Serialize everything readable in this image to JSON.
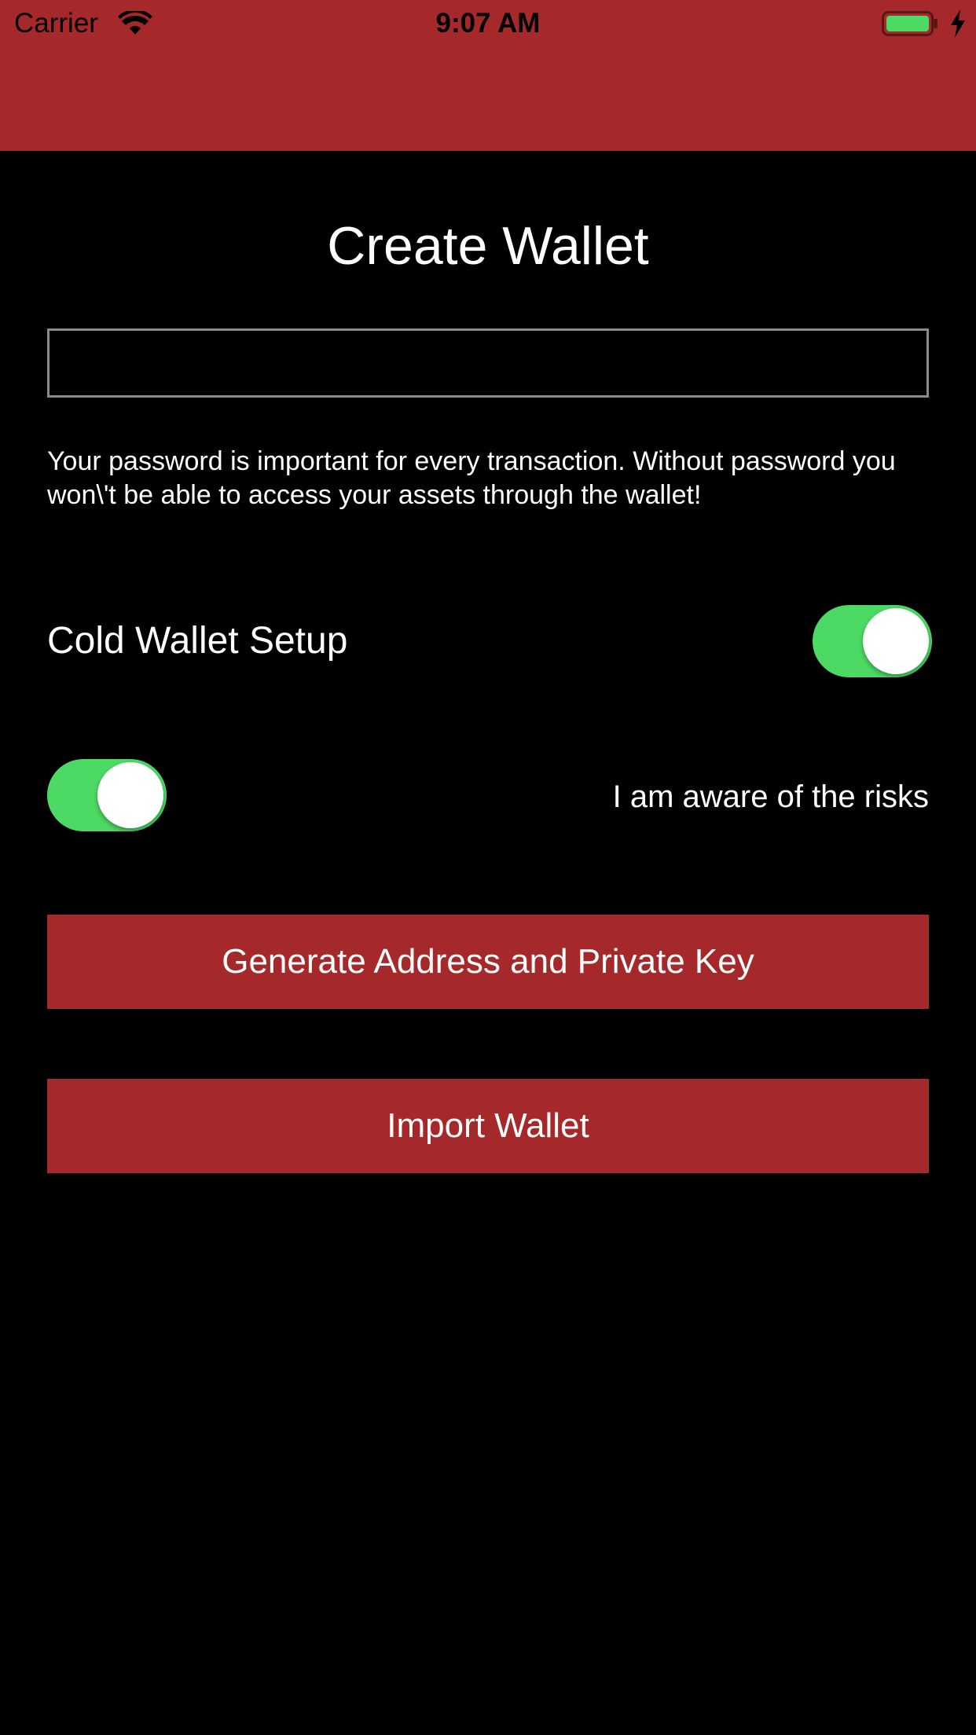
{
  "status_bar": {
    "carrier": "Carrier",
    "time": "9:07 AM",
    "wifi_icon": "wifi-icon",
    "battery_icon": "battery-icon",
    "charging_icon": "bolt-icon"
  },
  "colors": {
    "nav_bar": "#A5292A",
    "background": "#000000",
    "button": "#A5292A",
    "toggle_on": "#4CD964",
    "battery_fill": "#4CD964"
  },
  "main": {
    "title": "Create Wallet",
    "password_field": {
      "value": "",
      "placeholder": ""
    },
    "password_hint": "Your password is important for every transaction. Without password you won\\'t be able to access your assets through the wallet!",
    "cold_wallet": {
      "label": "Cold Wallet Setup",
      "on": true
    },
    "risk_awareness": {
      "label": "I am aware of the risks",
      "on": true
    },
    "generate_button_label": "Generate Address and Private Key",
    "import_button_label": "Import Wallet"
  }
}
